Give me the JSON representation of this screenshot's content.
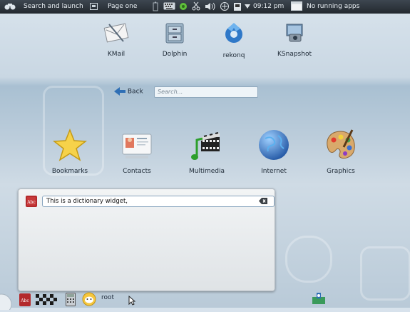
{
  "topbar": {
    "launcher_label": "Search and launch",
    "page_label": "Page one",
    "clock": "09:12 pm",
    "tasks_label": "No running apps"
  },
  "favorites": [
    {
      "label": "KMail",
      "icon": "mail-icon"
    },
    {
      "label": "Dolphin",
      "icon": "file-cabinet-icon"
    },
    {
      "label": "rekonq",
      "icon": "browser-icon"
    },
    {
      "label": "KSnapshot",
      "icon": "screenshot-icon"
    }
  ],
  "nav": {
    "back_label": "Back",
    "search_placeholder": "Search..."
  },
  "categories": [
    {
      "label": "Bookmarks",
      "icon": "star-icon"
    },
    {
      "label": "Contacts",
      "icon": "contact-card-icon"
    },
    {
      "label": "Multimedia",
      "icon": "multimedia-icon"
    },
    {
      "label": "Internet",
      "icon": "globe-icon"
    },
    {
      "label": "Graphics",
      "icon": "palette-icon"
    }
  ],
  "dictionary": {
    "input_value": "This is a dictionary widget,"
  },
  "bottombar": {
    "user_label": "root"
  }
}
